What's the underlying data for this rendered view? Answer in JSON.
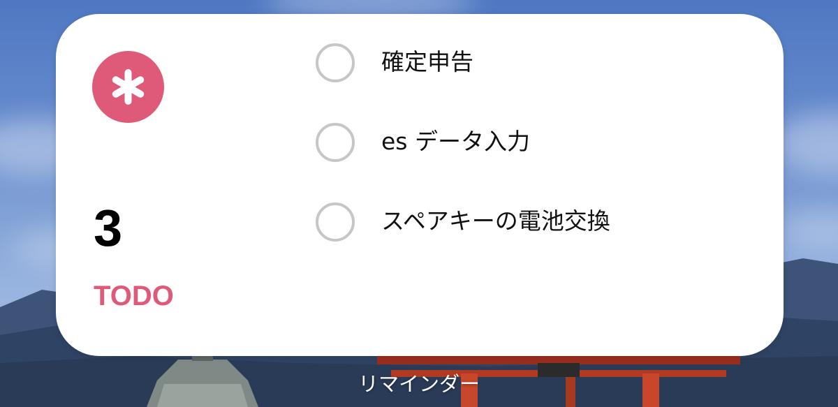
{
  "widget": {
    "app_icon": "asterisk-icon",
    "count": "3",
    "list_name": "TODO",
    "accent_color": "#df5a78",
    "tasks": [
      {
        "title": "確定申告",
        "completed": false
      },
      {
        "title": "es データ入力",
        "completed": false
      },
      {
        "title": "スペアキーの電池交換",
        "completed": false
      }
    ]
  },
  "widget_label": "リマインダー",
  "colors": {
    "card_background": "#ffffff",
    "checkbox_border": "#c6c6c8",
    "count_text": "#000000"
  }
}
